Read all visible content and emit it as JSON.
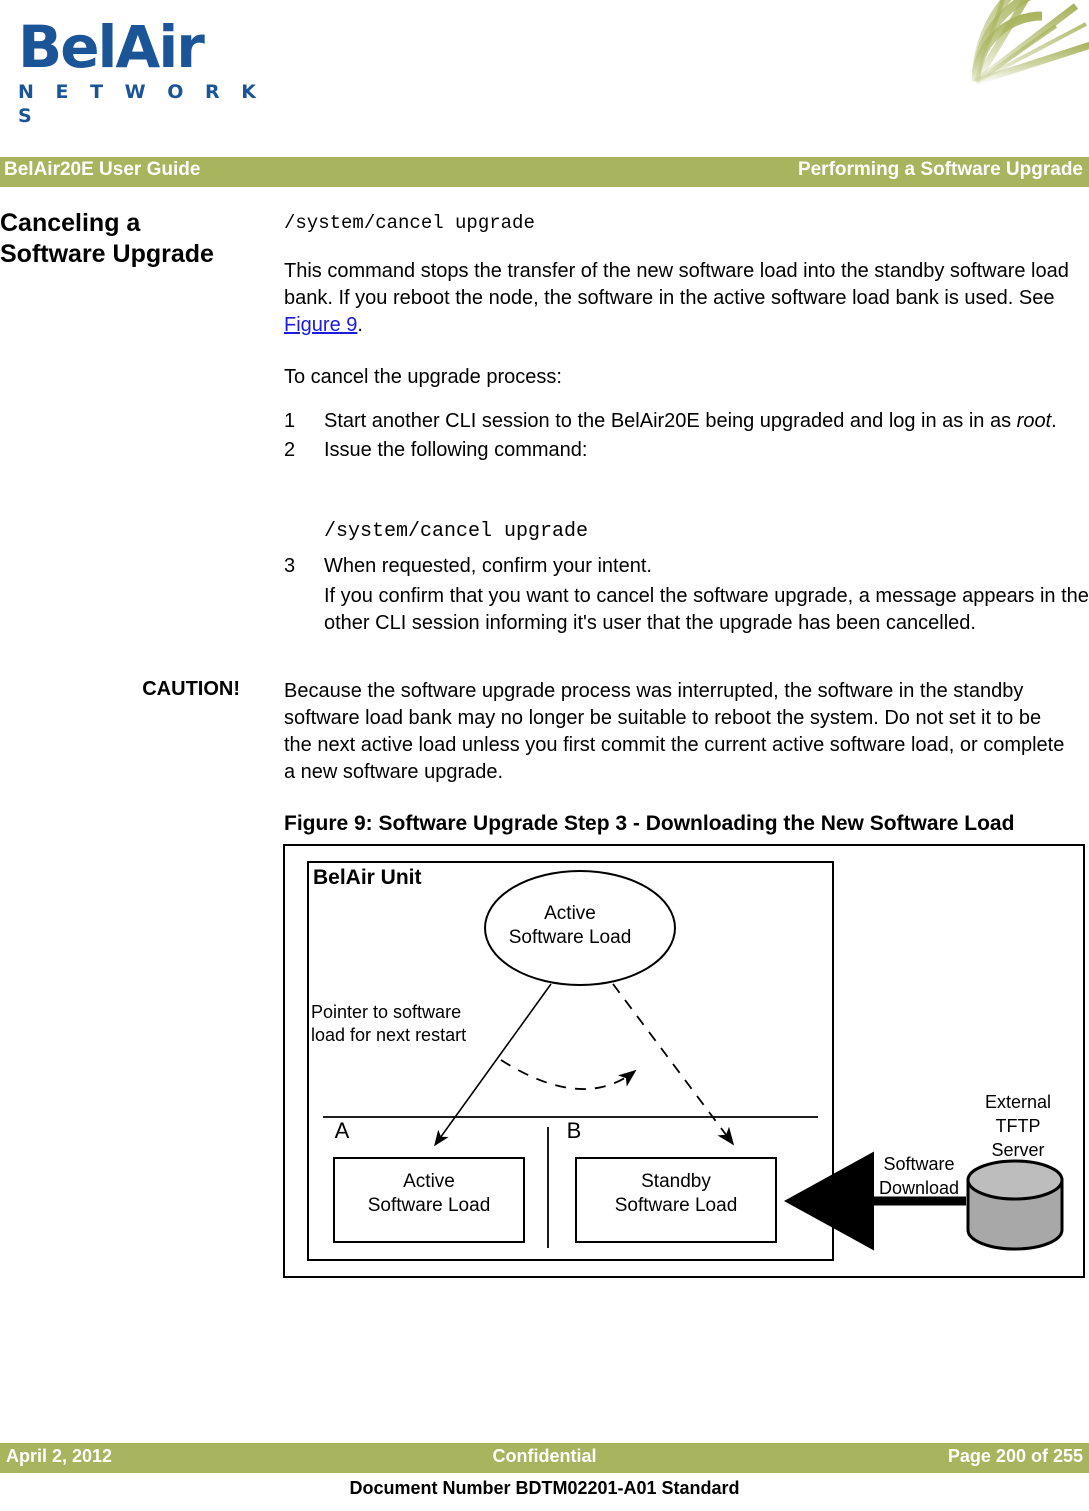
{
  "logo": {
    "wordmark": "BelAir",
    "tagline": "N E T W O R K S",
    "brand_blue": "#1b5597",
    "fan_icon": "network-fan-graphic",
    "fan_color": "#a9b45e"
  },
  "header": {
    "left": "BelAir20E User Guide",
    "right": "Performing a Software Upgrade",
    "bar_color": "#a9b45e"
  },
  "section": {
    "heading": "Canceling a Software Upgrade",
    "command_top": "/system/cancel upgrade",
    "intro_part1": "This command stops the transfer of the new software load into the standby software load bank. If you reboot the node, the software in the active software load bank is used. See ",
    "intro_link": "Figure 9",
    "intro_part2": ".",
    "link_color": "#1a1ae0",
    "lead_in": "To cancel the upgrade process:",
    "steps": [
      {
        "num": "1",
        "text_before": "Start another CLI session to the BelAir20E being upgraded and log in as in as ",
        "italic": "root",
        "text_after": "."
      },
      {
        "num": "2",
        "text_before": "Issue the following command:",
        "italic": "",
        "text_after": ""
      },
      {
        "num": "3",
        "text_before": "When requested, confirm your intent.",
        "italic": "",
        "text_after": ""
      }
    ],
    "step2_command": "/system/cancel upgrade",
    "step3_detail": "If you confirm that you want to cancel the software upgrade, a message appears in the other CLI session informing it's user that the upgrade has been cancelled."
  },
  "caution": {
    "label": "CAUTION!",
    "text": "Because the software upgrade process was interrupted, the software in the standby software load bank may no longer be suitable to reboot the system. Do not set it to be the next active load unless you first commit the current active software load, or complete a new software upgrade."
  },
  "figure": {
    "caption": "Figure 9: Software Upgrade Step 3 - Downloading the New Software Load",
    "unit_label": "BelAir Unit",
    "ellipse_line1": "Active",
    "ellipse_line2": "Software Load",
    "pointer_line1": "Pointer to software",
    "pointer_line2": "load for next restart",
    "bank_a_letter": "A",
    "bank_b_letter": "B",
    "bank_a_line1": "Active",
    "bank_a_line2": "Software Load",
    "bank_b_line1": "Standby",
    "bank_b_line2": "Software Load",
    "download_line1": "Software",
    "download_line2": "Download",
    "server_line1": "External",
    "server_line2": "TFTP",
    "server_line3": "Server",
    "server_icon": "database-cylinder-icon",
    "server_fill": "#a8a8a8"
  },
  "footer": {
    "date": "April 2, 2012",
    "center": "Confidential",
    "page": "Page 200 of 255",
    "document_number": "Document Number BDTM02201-A01 Standard"
  }
}
